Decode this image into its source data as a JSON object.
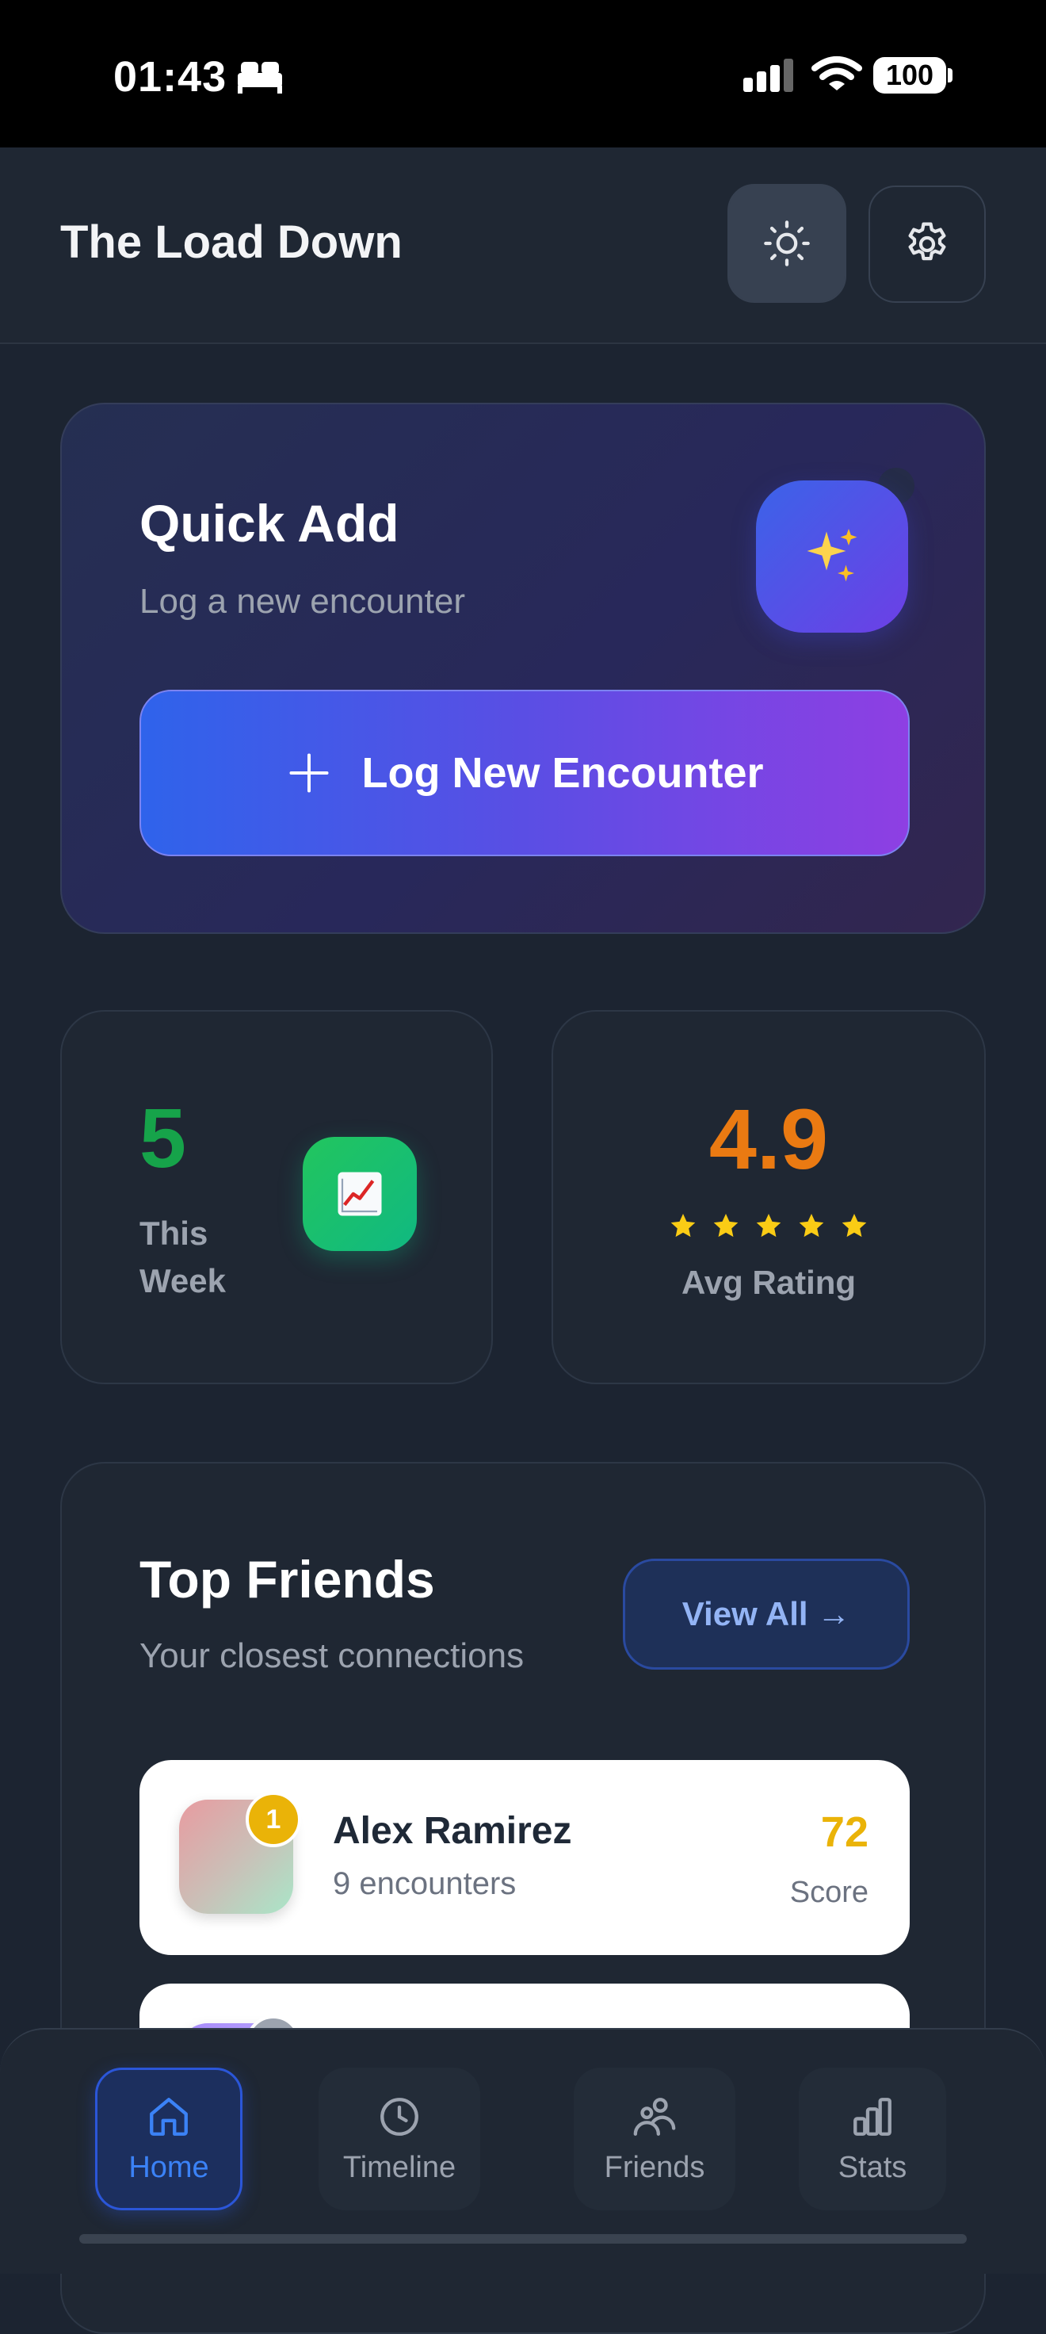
{
  "status_bar": {
    "time": "01:43",
    "battery": "100",
    "icons": [
      "bed-icon",
      "signal-icon",
      "wifi-icon",
      "battery-icon"
    ]
  },
  "header": {
    "title": "The Load Down",
    "theme_icon": "sun-icon",
    "settings_icon": "gear-icon"
  },
  "quick_add": {
    "title": "Quick Add",
    "subtitle": "Log a new encounter",
    "icon": "sparkles-icon",
    "button_label": "Log New Encounter",
    "button_icon": "plus-icon"
  },
  "stats": {
    "week_count": "5",
    "week_label": "This Week",
    "week_icon": "chart-increasing-icon",
    "avg_rating": "4.9",
    "stars": 5,
    "avg_label": "Avg Rating"
  },
  "top_friends": {
    "title": "Top Friends",
    "subtitle": "Your closest connections",
    "view_all": "View All →",
    "items": [
      {
        "rank": "1",
        "name": "Alex Ramirez",
        "encounters": "9 encounters",
        "score": "72",
        "score_label": "Score"
      },
      {
        "rank": "",
        "name": "",
        "encounters": "",
        "score": "",
        "score_label": ""
      }
    ]
  },
  "nav": {
    "items": [
      {
        "label": "Home",
        "icon": "home-icon",
        "active": true
      },
      {
        "label": "Timeline",
        "icon": "clock-icon",
        "active": false
      },
      {
        "label": "Friends",
        "icon": "friends-icon",
        "active": false
      },
      {
        "label": "Stats",
        "icon": "bar-chart-icon",
        "active": false
      }
    ]
  },
  "colors": {
    "background": "#1c2431",
    "accent_blue": "#3b82f6",
    "week_green": "#16a34a",
    "rating_orange": "#ea7a12",
    "star_yellow": "#eab308"
  }
}
